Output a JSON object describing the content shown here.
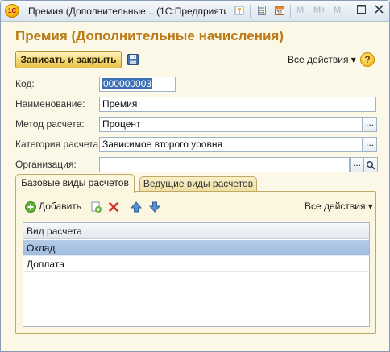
{
  "window": {
    "title": "Премия (Дополнительные... (1С:Предприятие)",
    "app_logo_text": "1С",
    "mbuttons": [
      "M",
      "M+",
      "M−"
    ]
  },
  "form": {
    "title": "Премия (Дополнительные начисления)",
    "save_close_label": "Записать и закрыть",
    "all_actions_label": "Все действия ▾",
    "help_label": "?"
  },
  "fields": {
    "code": {
      "label": "Код:",
      "value": "000000003"
    },
    "name": {
      "label": "Наименование:",
      "value": "Премия"
    },
    "method": {
      "label": "Метод расчета:",
      "value": "Процент"
    },
    "category": {
      "label": "Категория расчета:",
      "value": "Зависимое второго уровня"
    },
    "organization": {
      "label": "Организация:",
      "value": ""
    },
    "dots_label": "..."
  },
  "tabs": [
    {
      "label": "Базовые виды расчетов"
    },
    {
      "label": "Ведущие виды расчетов"
    }
  ],
  "table_toolbar": {
    "add_label": "Добавить",
    "all_actions_label": "Все действия ▾"
  },
  "table": {
    "column_header": "Вид расчета",
    "rows": [
      {
        "name": "Оклад"
      },
      {
        "name": "Доплата"
      }
    ]
  },
  "colors": {
    "title": "#ba7a15",
    "selection": "#3c6fb4",
    "selected_row": "#9fbde0"
  }
}
